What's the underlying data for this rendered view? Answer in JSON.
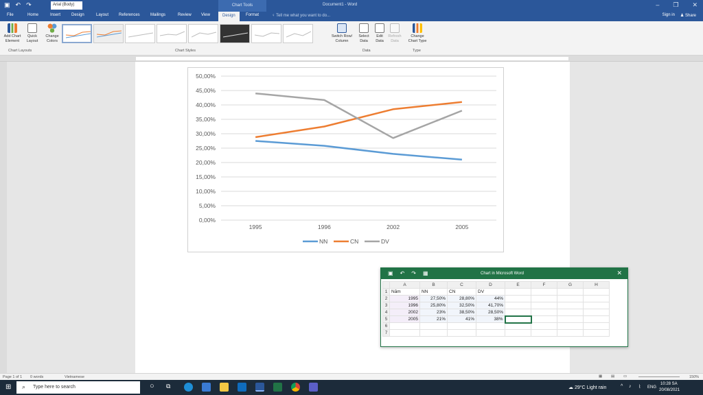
{
  "titlebar": {
    "font_box": "Arial (Body)",
    "context_tab": "Chart Tools",
    "document_title": "Document1 - Word"
  },
  "menu": {
    "tabs": [
      "File",
      "Home",
      "Insert",
      "Design",
      "Layout",
      "References",
      "Mailings",
      "Review",
      "View",
      "Design",
      "Format"
    ],
    "tell_me": "Tell me what you want to do...",
    "sign_in": "Sign in",
    "share": "Share"
  },
  "ribbon": {
    "add_chart_element": "Add Chart Element",
    "quick_layout": "Quick Layout",
    "change_colors": "Change Colors",
    "switch_row_column": "Switch Row/ Column",
    "select_data": "Select Data",
    "edit_data": "Edit Data",
    "refresh_data": "Refresh Data",
    "change_chart_type": "Change Chart Type",
    "group_chart_layouts": "Chart Layouts",
    "group_chart_styles": "Chart Styles",
    "group_data": "Data",
    "group_type": "Type"
  },
  "chart_data": {
    "type": "line",
    "categories": [
      "1995",
      "1996",
      "2002",
      "2005"
    ],
    "series": [
      {
        "name": "NN",
        "values": [
          27.5,
          25.8,
          23,
          21
        ],
        "color": "#5b9bd5"
      },
      {
        "name": "CN",
        "values": [
          28.8,
          32.5,
          38.5,
          41
        ],
        "color": "#ed7d31"
      },
      {
        "name": "DV",
        "values": [
          44,
          41.7,
          28.5,
          38
        ],
        "color": "#a5a5a5"
      }
    ],
    "y_ticks": [
      "0,00%",
      "5,00%",
      "10,00%",
      "15,00%",
      "20,00%",
      "25,00%",
      "30,00%",
      "35,00%",
      "40,00%",
      "45,00%",
      "50,00%"
    ],
    "ylim": [
      0,
      50
    ],
    "grid": true,
    "legend_position": "bottom"
  },
  "excel": {
    "title": "Chart in Microsoft Word",
    "columns": [
      "A",
      "B",
      "C",
      "D",
      "E",
      "F",
      "G",
      "H"
    ],
    "row_numbers": [
      "1",
      "2",
      "3",
      "4",
      "5",
      "6",
      "7"
    ],
    "rows": [
      [
        "Năm",
        "NN",
        "CN",
        "DV"
      ],
      [
        "1995",
        "27,50%",
        "28,80%",
        "44%"
      ],
      [
        "1996",
        "25,80%",
        "32,50%",
        "41,70%"
      ],
      [
        "2002",
        "23%",
        "38,50%",
        "28,50%"
      ],
      [
        "2005",
        "21%",
        "41%",
        "38%"
      ]
    ]
  },
  "status": {
    "page": "Page 1 of 1",
    "words": "0 words",
    "language": "Vietnamese",
    "zoom": "150%"
  },
  "taskbar": {
    "search_placeholder": "Type here to search",
    "weather": "29°C Light rain",
    "lang": "ENG",
    "time": "10:28 SA",
    "date": "20/08/2021"
  }
}
